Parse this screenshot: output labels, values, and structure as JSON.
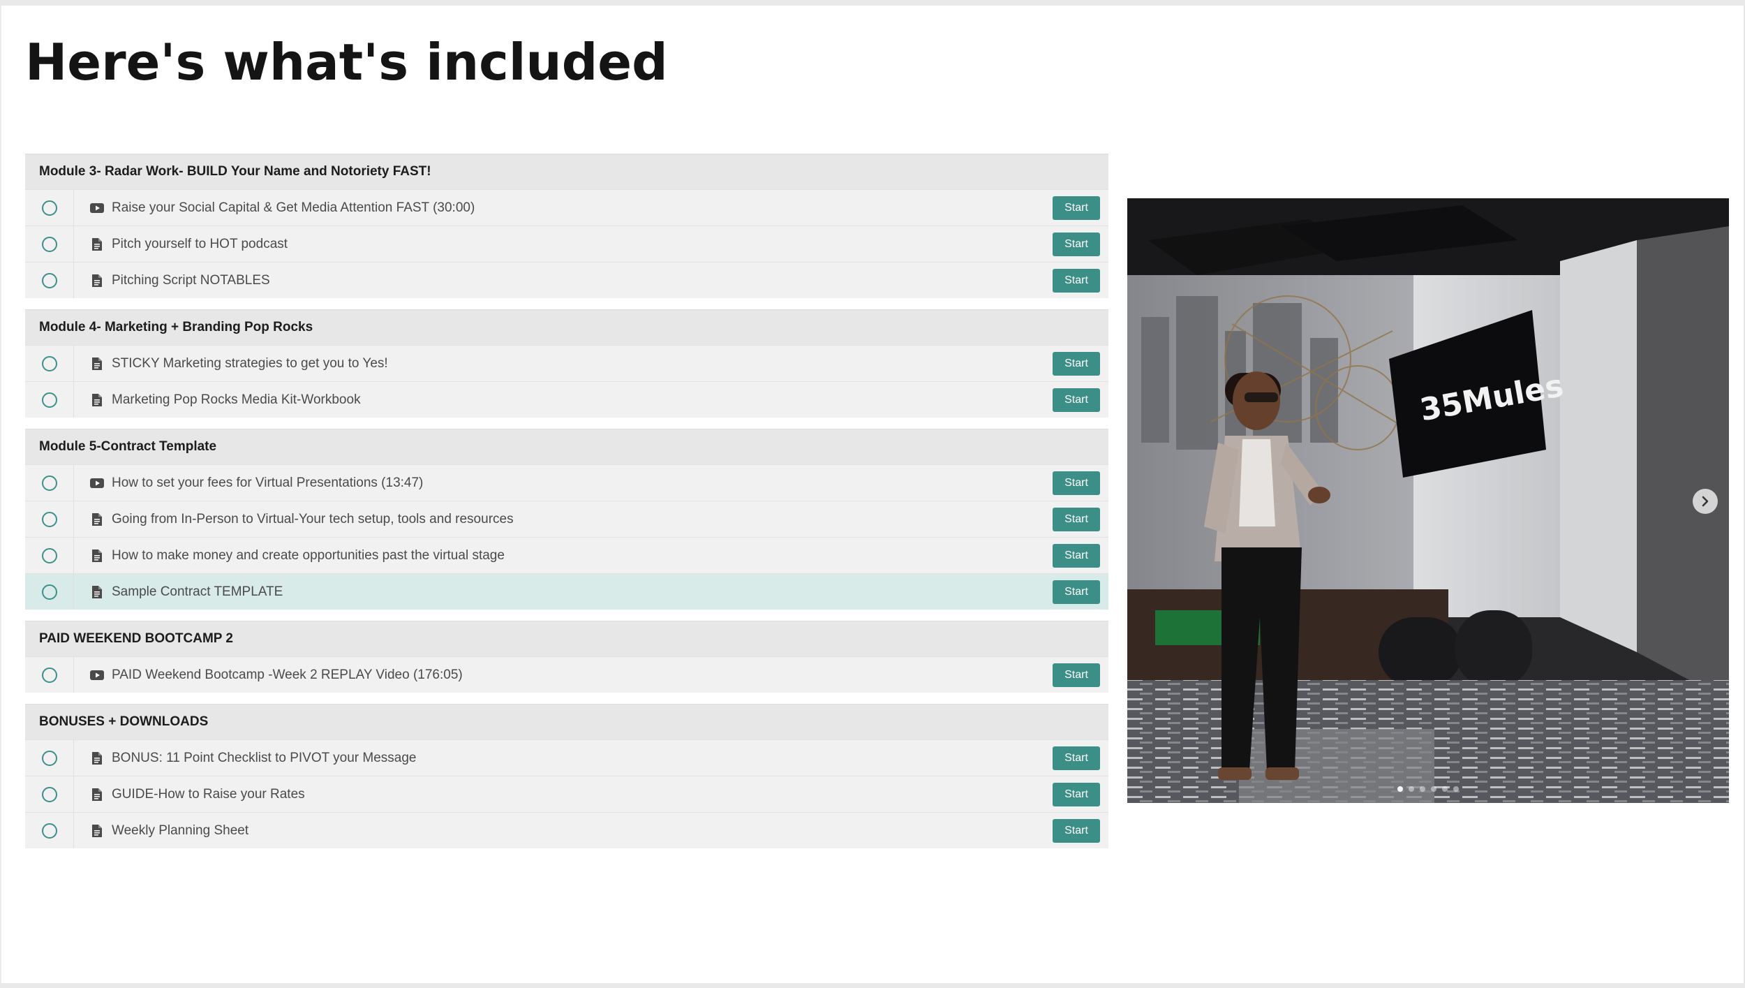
{
  "heading": "Here's what's included",
  "sections": [
    {
      "title": "Module 3- Radar Work- BUILD Your Name and Notoriety FAST!",
      "lectures": [
        {
          "title": "Raise your Social Capital & Get Media Attention FAST (30:00)",
          "type": "video-icon",
          "button": "Start"
        },
        {
          "title": "Pitch yourself to HOT podcast",
          "type": "document-icon",
          "button": "Start"
        },
        {
          "title": "Pitching Script NOTABLES",
          "type": "document-icon",
          "button": "Start"
        }
      ]
    },
    {
      "title": "Module 4- Marketing + Branding Pop Rocks",
      "lectures": [
        {
          "title": "STICKY Marketing strategies to get you to Yes!",
          "type": "document-icon",
          "button": "Start"
        },
        {
          "title": "Marketing Pop Rocks Media Kit-Workbook",
          "type": "document-icon",
          "button": "Start"
        }
      ]
    },
    {
      "title": "Module 5-Contract Template",
      "lectures": [
        {
          "title": "How to set your fees for Virtual Presentations (13:47)",
          "type": "video-icon",
          "button": "Start"
        },
        {
          "title": "Going from In-Person to Virtual-Your tech setup, tools and resources",
          "type": "document-icon",
          "button": "Start"
        },
        {
          "title": "How to make money and create opportunities past the virtual stage",
          "type": "document-icon",
          "button": "Start"
        },
        {
          "title": "Sample Contract TEMPLATE",
          "type": "document-icon",
          "button": "Start",
          "highlighted": true
        }
      ]
    },
    {
      "title": "PAID WEEKEND BOOTCAMP 2",
      "lectures": [
        {
          "title": "PAID Weekend Bootcamp -Week 2 REPLAY Video (176:05)",
          "type": "video-icon",
          "button": "Start"
        }
      ]
    },
    {
      "title": "BONUSES + DOWNLOADS",
      "lectures": [
        {
          "title": "BONUS: 11 Point Checklist to PIVOT your Message",
          "type": "document-icon",
          "button": "Start"
        },
        {
          "title": "GUIDE-How to Raise your Rates",
          "type": "document-icon",
          "button": "Start"
        },
        {
          "title": "Weekly Planning Sheet",
          "type": "document-icon",
          "button": "Start"
        }
      ]
    }
  ],
  "carousel": {
    "screen_text": "35Mules",
    "next_icon": "chevron-right-icon",
    "slide_count": 6,
    "active_slide": 1
  },
  "colors": {
    "accent": "#3b8f86",
    "highlight_row": "#d8ebe8",
    "section_header": "#e7e7e7",
    "row": "#f1f1f1"
  }
}
